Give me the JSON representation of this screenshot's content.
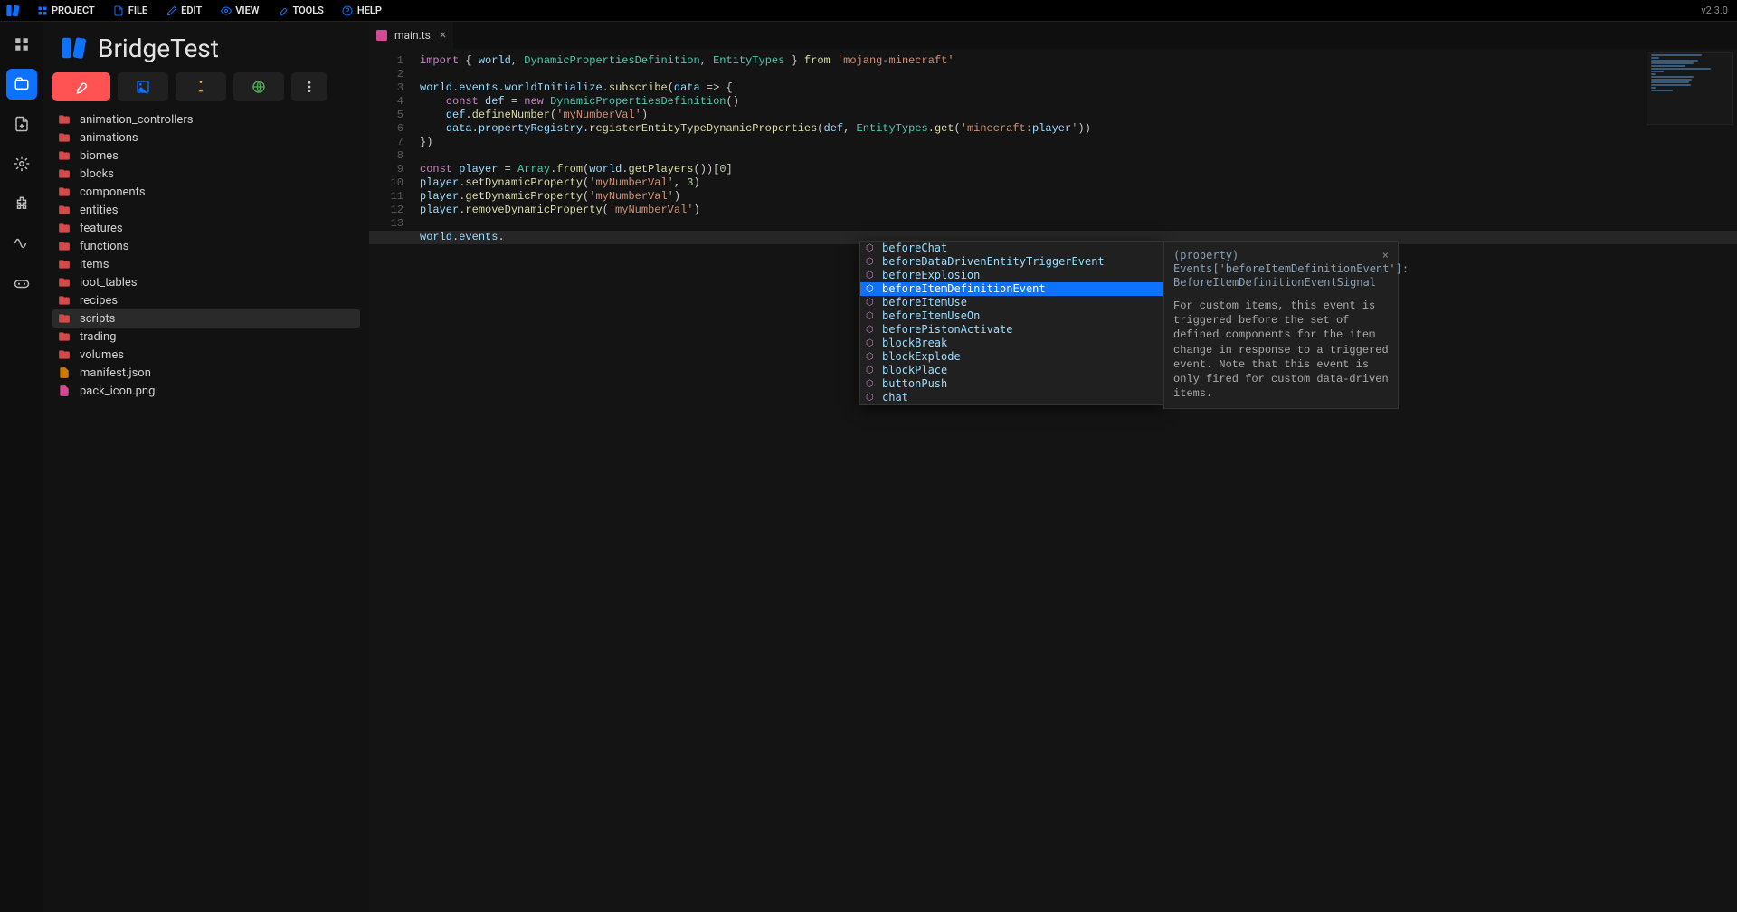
{
  "app": {
    "version": "v2.3.0"
  },
  "menu": {
    "items": [
      {
        "label": "PROJECT",
        "icon": "grid"
      },
      {
        "label": "FILE",
        "icon": "file"
      },
      {
        "label": "EDIT",
        "icon": "pencil"
      },
      {
        "label": "VIEW",
        "icon": "eye"
      },
      {
        "label": "TOOLS",
        "icon": "wrench"
      },
      {
        "label": "HELP",
        "icon": "help"
      }
    ]
  },
  "rail": {
    "items": [
      "dashboard",
      "folder",
      "file-add",
      "settings",
      "extension",
      "wave",
      "controller"
    ],
    "active_index": 1
  },
  "sidebar": {
    "project_name": "BridgeTest",
    "toolbar_icons": [
      "wrench",
      "image",
      "accessibility",
      "globe",
      "more"
    ],
    "tree": [
      {
        "type": "folder",
        "label": "animation_controllers"
      },
      {
        "type": "folder",
        "label": "animations"
      },
      {
        "type": "folder",
        "label": "biomes"
      },
      {
        "type": "folder",
        "label": "blocks"
      },
      {
        "type": "folder",
        "label": "components"
      },
      {
        "type": "folder",
        "label": "entities"
      },
      {
        "type": "folder",
        "label": "features"
      },
      {
        "type": "folder",
        "label": "functions"
      },
      {
        "type": "folder",
        "label": "items"
      },
      {
        "type": "folder",
        "label": "loot_tables"
      },
      {
        "type": "folder",
        "label": "recipes"
      },
      {
        "type": "folder",
        "label": "scripts",
        "selected": true
      },
      {
        "type": "folder",
        "label": "trading"
      },
      {
        "type": "folder",
        "label": "volumes"
      },
      {
        "type": "file",
        "label": "manifest.json",
        "icon": "json"
      },
      {
        "type": "file",
        "label": "pack_icon.png",
        "icon": "image"
      }
    ]
  },
  "editor": {
    "tab": {
      "label": "main.ts"
    },
    "line_count": 14,
    "code_lines": [
      "import { world, DynamicPropertiesDefinition, EntityTypes } from 'mojang-minecraft'",
      "",
      "world.events.worldInitialize.subscribe(data => {",
      "    const def = new DynamicPropertiesDefinition()",
      "    def.defineNumber('myNumberVal')",
      "    data.propertyRegistry.registerEntityTypeDynamicProperties(def, EntityTypes.get('minecraft:player'))",
      "})",
      "",
      "const player = Array.from(world.getPlayers())[0]",
      "player.setDynamicProperty('myNumberVal', 3)",
      "player.getDynamicProperty('myNumberVal')",
      "player.removeDynamicProperty('myNumberVal')",
      "",
      "world.events."
    ],
    "autocomplete": {
      "selected_index": 3,
      "items": [
        "beforeChat",
        "beforeDataDrivenEntityTriggerEvent",
        "beforeExplosion",
        "beforeItemDefinitionEvent",
        "beforeItemUse",
        "beforeItemUseOn",
        "beforePistonActivate",
        "blockBreak",
        "blockExplode",
        "blockPlace",
        "buttonPush",
        "chat"
      ]
    },
    "doc_popup": {
      "signature": "(property) Events['beforeItemDefinitionEvent']: BeforeItemDefinitionEventSignal",
      "description": "For custom items, this event is triggered before the set of defined components for the item change in response to a triggered event. Note that this event is only fired for custom data-driven items."
    }
  }
}
